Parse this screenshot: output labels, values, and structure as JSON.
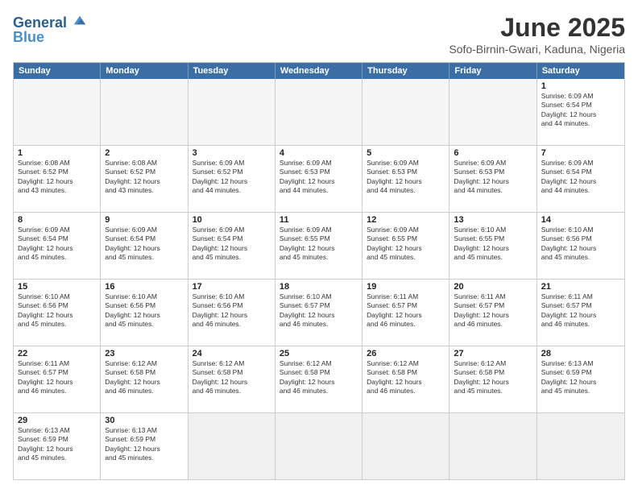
{
  "header": {
    "logo_line1": "General",
    "logo_line2": "Blue",
    "month": "June 2025",
    "location": "Sofo-Birnin-Gwari, Kaduna, Nigeria"
  },
  "weekdays": [
    "Sunday",
    "Monday",
    "Tuesday",
    "Wednesday",
    "Thursday",
    "Friday",
    "Saturday"
  ],
  "rows": [
    [
      {
        "day": "",
        "empty": true
      },
      {
        "day": "",
        "empty": true
      },
      {
        "day": "",
        "empty": true
      },
      {
        "day": "",
        "empty": true
      },
      {
        "day": "",
        "empty": true
      },
      {
        "day": "",
        "empty": true
      },
      {
        "day": "1",
        "text": "Sunrise: 6:09 AM\nSunset: 6:54 PM\nDaylight: 12 hours\nand 44 minutes."
      }
    ],
    [
      {
        "day": "1",
        "text": "Sunrise: 6:08 AM\nSunset: 6:52 PM\nDaylight: 12 hours\nand 43 minutes."
      },
      {
        "day": "2",
        "text": "Sunrise: 6:08 AM\nSunset: 6:52 PM\nDaylight: 12 hours\nand 43 minutes."
      },
      {
        "day": "3",
        "text": "Sunrise: 6:09 AM\nSunset: 6:52 PM\nDaylight: 12 hours\nand 44 minutes."
      },
      {
        "day": "4",
        "text": "Sunrise: 6:09 AM\nSunset: 6:53 PM\nDaylight: 12 hours\nand 44 minutes."
      },
      {
        "day": "5",
        "text": "Sunrise: 6:09 AM\nSunset: 6:53 PM\nDaylight: 12 hours\nand 44 minutes."
      },
      {
        "day": "6",
        "text": "Sunrise: 6:09 AM\nSunset: 6:53 PM\nDaylight: 12 hours\nand 44 minutes."
      },
      {
        "day": "7",
        "text": "Sunrise: 6:09 AM\nSunset: 6:54 PM\nDaylight: 12 hours\nand 44 minutes."
      }
    ],
    [
      {
        "day": "8",
        "text": "Sunrise: 6:09 AM\nSunset: 6:54 PM\nDaylight: 12 hours\nand 45 minutes."
      },
      {
        "day": "9",
        "text": "Sunrise: 6:09 AM\nSunset: 6:54 PM\nDaylight: 12 hours\nand 45 minutes."
      },
      {
        "day": "10",
        "text": "Sunrise: 6:09 AM\nSunset: 6:54 PM\nDaylight: 12 hours\nand 45 minutes."
      },
      {
        "day": "11",
        "text": "Sunrise: 6:09 AM\nSunset: 6:55 PM\nDaylight: 12 hours\nand 45 minutes."
      },
      {
        "day": "12",
        "text": "Sunrise: 6:09 AM\nSunset: 6:55 PM\nDaylight: 12 hours\nand 45 minutes."
      },
      {
        "day": "13",
        "text": "Sunrise: 6:10 AM\nSunset: 6:55 PM\nDaylight: 12 hours\nand 45 minutes."
      },
      {
        "day": "14",
        "text": "Sunrise: 6:10 AM\nSunset: 6:56 PM\nDaylight: 12 hours\nand 45 minutes."
      }
    ],
    [
      {
        "day": "15",
        "text": "Sunrise: 6:10 AM\nSunset: 6:56 PM\nDaylight: 12 hours\nand 45 minutes."
      },
      {
        "day": "16",
        "text": "Sunrise: 6:10 AM\nSunset: 6:56 PM\nDaylight: 12 hours\nand 45 minutes."
      },
      {
        "day": "17",
        "text": "Sunrise: 6:10 AM\nSunset: 6:56 PM\nDaylight: 12 hours\nand 46 minutes."
      },
      {
        "day": "18",
        "text": "Sunrise: 6:10 AM\nSunset: 6:57 PM\nDaylight: 12 hours\nand 46 minutes."
      },
      {
        "day": "19",
        "text": "Sunrise: 6:11 AM\nSunset: 6:57 PM\nDaylight: 12 hours\nand 46 minutes."
      },
      {
        "day": "20",
        "text": "Sunrise: 6:11 AM\nSunset: 6:57 PM\nDaylight: 12 hours\nand 46 minutes."
      },
      {
        "day": "21",
        "text": "Sunrise: 6:11 AM\nSunset: 6:57 PM\nDaylight: 12 hours\nand 46 minutes."
      }
    ],
    [
      {
        "day": "22",
        "text": "Sunrise: 6:11 AM\nSunset: 6:57 PM\nDaylight: 12 hours\nand 46 minutes."
      },
      {
        "day": "23",
        "text": "Sunrise: 6:12 AM\nSunset: 6:58 PM\nDaylight: 12 hours\nand 46 minutes."
      },
      {
        "day": "24",
        "text": "Sunrise: 6:12 AM\nSunset: 6:58 PM\nDaylight: 12 hours\nand 46 minutes."
      },
      {
        "day": "25",
        "text": "Sunrise: 6:12 AM\nSunset: 6:58 PM\nDaylight: 12 hours\nand 46 minutes."
      },
      {
        "day": "26",
        "text": "Sunrise: 6:12 AM\nSunset: 6:58 PM\nDaylight: 12 hours\nand 46 minutes."
      },
      {
        "day": "27",
        "text": "Sunrise: 6:12 AM\nSunset: 6:58 PM\nDaylight: 12 hours\nand 45 minutes."
      },
      {
        "day": "28",
        "text": "Sunrise: 6:13 AM\nSunset: 6:59 PM\nDaylight: 12 hours\nand 45 minutes."
      }
    ],
    [
      {
        "day": "29",
        "text": "Sunrise: 6:13 AM\nSunset: 6:59 PM\nDaylight: 12 hours\nand 45 minutes."
      },
      {
        "day": "30",
        "text": "Sunrise: 6:13 AM\nSunset: 6:59 PM\nDaylight: 12 hours\nand 45 minutes."
      },
      {
        "day": "",
        "empty": true,
        "shaded": true
      },
      {
        "day": "",
        "empty": true,
        "shaded": true
      },
      {
        "day": "",
        "empty": true,
        "shaded": true
      },
      {
        "day": "",
        "empty": true,
        "shaded": true
      },
      {
        "day": "",
        "empty": true,
        "shaded": true
      }
    ]
  ]
}
